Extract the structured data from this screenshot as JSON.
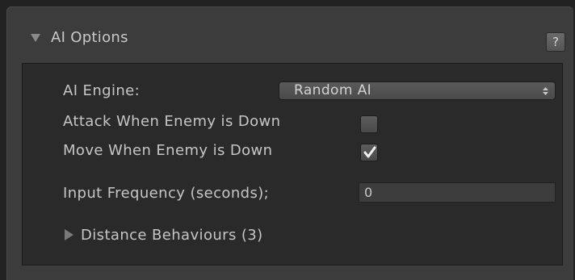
{
  "header": {
    "title": "AI Options",
    "help_label": "?"
  },
  "fields": {
    "ai_engine": {
      "label": "AI Engine:",
      "value": "Random AI"
    },
    "attack_when_down": {
      "label": "Attack When Enemy is Down",
      "checked": false
    },
    "move_when_down": {
      "label": "Move When Enemy is Down",
      "checked": true
    },
    "input_frequency": {
      "label": "Input Frequency (seconds);",
      "value": "0"
    }
  },
  "distance_behaviours": {
    "label": "Distance Behaviours (3)"
  },
  "colors": {
    "panel": "#3c3c3c",
    "content": "#2a2a2a",
    "text": "#c6c6c6"
  }
}
